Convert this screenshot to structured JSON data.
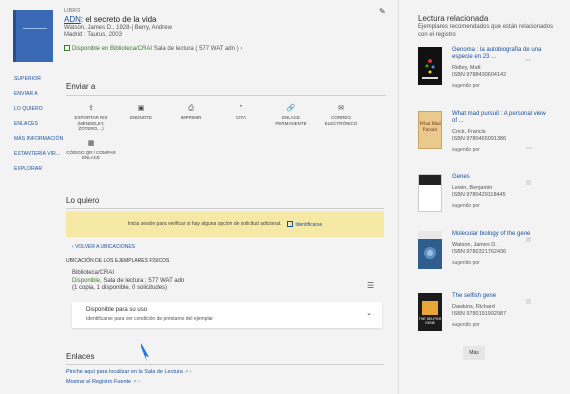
{
  "record": {
    "type": "LIBRO",
    "title_linked": "ADN",
    "title_rest": ": el secreto de la vida",
    "authors": "Watson, James D., 1928-| Berry, Andrew",
    "publisher": "Madrid : Taurus, 2003",
    "availability_status": "Disponible en Biblioteca/CRAI",
    "availability_location": "Sala de lectura ( 577 WAT adn )"
  },
  "leftnav": [
    "SUPERIOR",
    "ENVIAR A",
    "LO QUIERO",
    "ENLACES",
    "MÁS INFORMACIÓN",
    "ESTANTERÍA VIR...",
    "EXPLORAR"
  ],
  "send": {
    "heading": "Enviar a",
    "items": [
      {
        "label": "EXPORTAR RIS (MENDELEY, ZOTERO,...)",
        "icon": "export-icon"
      },
      {
        "label": "ENDNOTE",
        "icon": "endnote-icon"
      },
      {
        "label": "IMPRIMIR",
        "icon": "print-icon"
      },
      {
        "label": "CITA",
        "icon": "quote-icon"
      },
      {
        "label": "ENLACE PERMANENTE",
        "icon": "link-icon"
      },
      {
        "label": "CORREO ELECTRÓNICO",
        "icon": "email-icon"
      }
    ],
    "qr_label": "CÓDIGO QR / COMPAR ENLACE"
  },
  "quiero": {
    "heading": "Lo quiero",
    "alert_text": "Inicia sesión para verificar si hay alguna opción de solicitud adicional.",
    "login_label": "Identificarse",
    "back_label": "VOLVER A UBICACIONES",
    "holdings_heading": "UBICACIÓN DE LOS EJEMPLARES FÍSICOS",
    "library": "Biblioteca/CRAI",
    "status": "Disponible",
    "location": ", Sala de lectura ; 577 WAT adn",
    "copies": "(1 copia, 1 disponible, 0 solicitudes)",
    "card_title": "Disponible para su uso",
    "card_sub": "Identificarse para ver condición de préstamo del ejemplar"
  },
  "enlaces": {
    "heading": "Enlaces",
    "link1": "Pinche aquí para localizar en la Sala de Lectura",
    "link2": "Mostrar el Registro Fuente"
  },
  "related": {
    "heading": "Lectura relacionada",
    "sub": "Ejemplares recomendados que están relacionados con el registro",
    "items": [
      {
        "title": "Genoma : la autobiografía de una especie en 23 ...",
        "author": "Ridley, Matt",
        "isbn": "ISBN 9788430604142",
        "suggested": "sugerido por"
      },
      {
        "title": "What mad pursuit : A personal view of ...",
        "author": "Crick, Francis",
        "isbn": "ISBN 9780465091386",
        "suggested": "sugerido por",
        "cover_text": "What Mad Pursuit"
      },
      {
        "title": "Genes",
        "author": "Lewin, Benjamin",
        "isbn": "ISBN 9780429118445",
        "suggested": "sugerido por"
      },
      {
        "title": "Molecular biology of the gene",
        "author": "Watson, James D.",
        "isbn": "ISBN 9780321762436",
        "suggested": "sugerido por"
      },
      {
        "title": "The selfish gene",
        "author": "Dawkins, Richard",
        "isbn": "ISBN 9780191902987",
        "suggested": "sugerido por",
        "cover_text": "THE SELFISH GENE"
      }
    ],
    "more_label": "Más"
  }
}
